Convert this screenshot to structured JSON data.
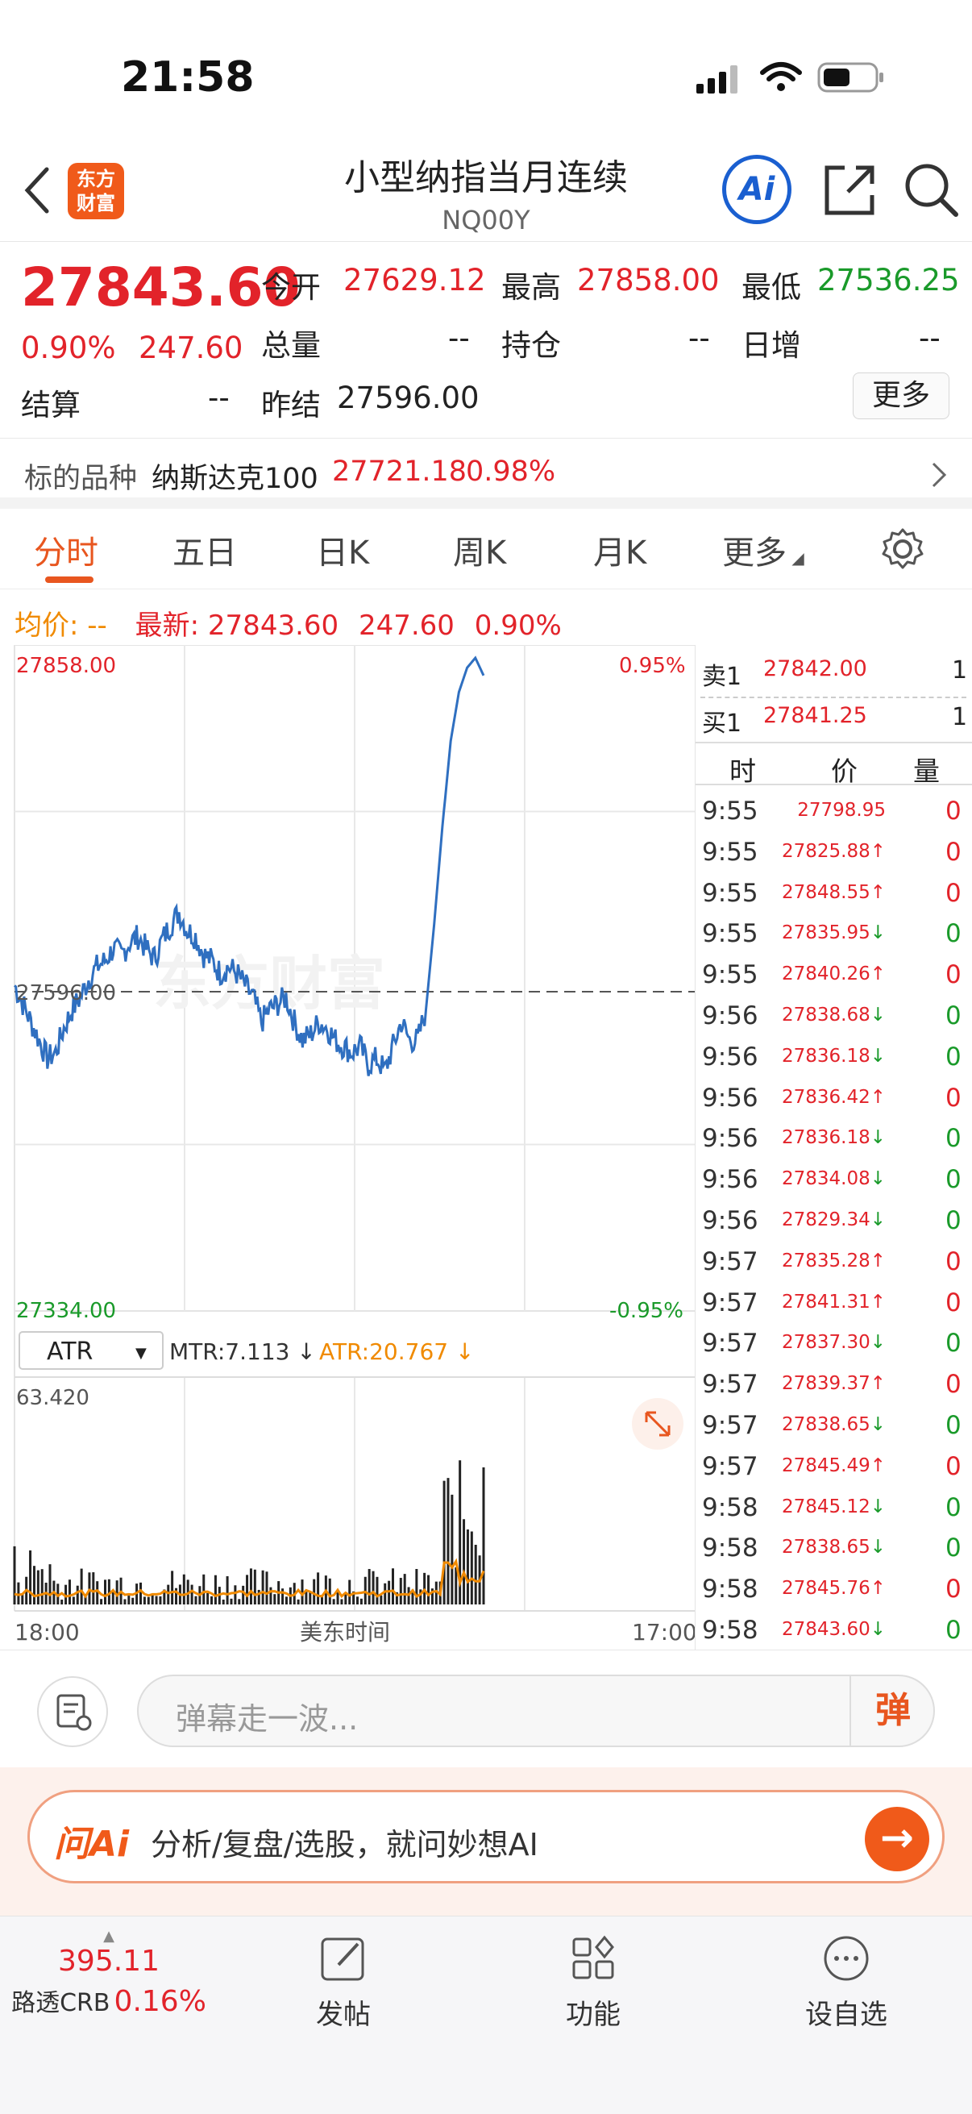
{
  "status_bar": {
    "time": "21:58"
  },
  "header": {
    "title": "小型纳指当月连续",
    "code": "NQ00Y",
    "logo_text": "东方财富",
    "ai_label": "Ai"
  },
  "quote": {
    "price": "27843.60",
    "change_pct": "0.90%",
    "change": "247.60",
    "open_label": "今开",
    "open": "27629.12",
    "high_label": "最高",
    "high": "27858.00",
    "low_label": "最低",
    "low": "27536.25",
    "volume_label": "总量",
    "volume": "--",
    "position_label": "持仓",
    "position": "--",
    "daily_inc_label": "日增",
    "daily_inc": "--",
    "settle_label": "结算",
    "settle": "--",
    "prev_settle_label": "昨结",
    "prev_settle": "27596.00",
    "more_label": "更多"
  },
  "underlying": {
    "label": "标的品种",
    "name": "纳斯达克100",
    "price": "27721.18",
    "pct": "0.98%"
  },
  "tabs": [
    "分时",
    "五日",
    "日K",
    "周K",
    "月K",
    "更多"
  ],
  "avg_row": {
    "avg_label": "均价:",
    "avg_value": "--",
    "latest_label": "最新:",
    "latest": "27843.60",
    "change": "247.60",
    "pct": "0.90%"
  },
  "chart_data": {
    "type": "line",
    "price_top": "27858.00",
    "price_bottom": "27334.00",
    "price_mid": "27596.00",
    "pct_top": "0.95%",
    "pct_bottom": "-0.95%",
    "ylim": [
      27334.0,
      27858.0
    ],
    "series": [
      {
        "values": [
          27590,
          27575,
          27560,
          27545,
          27530,
          27535,
          27555,
          27570,
          27580,
          27595,
          27605,
          27610,
          27620,
          27615,
          27625,
          27630,
          27620,
          27612,
          27628,
          27640,
          27650,
          27635,
          27630,
          27615,
          27610,
          27600,
          27605,
          27600,
          27590,
          27580,
          27560,
          27570,
          27575,
          27580,
          27560,
          27545,
          27550,
          27560,
          27555,
          27545,
          27540,
          27535,
          27540,
          27525,
          27530,
          27520,
          27540,
          27560,
          27545,
          27545,
          27570,
          27640,
          27720,
          27790,
          27830,
          27850,
          27858,
          27843.6
        ]
      }
    ],
    "indicator": {
      "selector": "ATR",
      "mtr_label": "MTR:7.113",
      "atr_label": "ATR:20.767",
      "max_label": "63.420",
      "x_start": "18:00",
      "x_mid": "美东时间",
      "x_end": "17:00"
    }
  },
  "order_book": {
    "sell_label": "卖1",
    "sell_price": "27842.00",
    "sell_qty": "1",
    "buy_label": "买1",
    "buy_price": "27841.25",
    "buy_qty": "1",
    "col_time": "时",
    "col_price": "价",
    "col_qty": "量",
    "ticks": [
      {
        "t": "9:55",
        "p": "27798.95",
        "d": "",
        "v": "0",
        "c": "red"
      },
      {
        "t": "9:55",
        "p": "27825.88",
        "d": "↑",
        "v": "0",
        "c": "red"
      },
      {
        "t": "9:55",
        "p": "27848.55",
        "d": "↑",
        "v": "0",
        "c": "red"
      },
      {
        "t": "9:55",
        "p": "27835.95",
        "d": "↓",
        "v": "0",
        "c": "green"
      },
      {
        "t": "9:55",
        "p": "27840.26",
        "d": "↑",
        "v": "0",
        "c": "red"
      },
      {
        "t": "9:56",
        "p": "27838.68",
        "d": "↓",
        "v": "0",
        "c": "green"
      },
      {
        "t": "9:56",
        "p": "27836.18",
        "d": "↓",
        "v": "0",
        "c": "green"
      },
      {
        "t": "9:56",
        "p": "27836.42",
        "d": "↑",
        "v": "0",
        "c": "red"
      },
      {
        "t": "9:56",
        "p": "27836.18",
        "d": "↓",
        "v": "0",
        "c": "green"
      },
      {
        "t": "9:56",
        "p": "27834.08",
        "d": "↓",
        "v": "0",
        "c": "green"
      },
      {
        "t": "9:56",
        "p": "27829.34",
        "d": "↓",
        "v": "0",
        "c": "green"
      },
      {
        "t": "9:57",
        "p": "27835.28",
        "d": "↑",
        "v": "0",
        "c": "red"
      },
      {
        "t": "9:57",
        "p": "27841.31",
        "d": "↑",
        "v": "0",
        "c": "red"
      },
      {
        "t": "9:57",
        "p": "27837.30",
        "d": "↓",
        "v": "0",
        "c": "green"
      },
      {
        "t": "9:57",
        "p": "27839.37",
        "d": "↑",
        "v": "0",
        "c": "red"
      },
      {
        "t": "9:57",
        "p": "27838.65",
        "d": "↓",
        "v": "0",
        "c": "green"
      },
      {
        "t": "9:57",
        "p": "27845.49",
        "d": "↑",
        "v": "0",
        "c": "red"
      },
      {
        "t": "9:58",
        "p": "27845.12",
        "d": "↓",
        "v": "0",
        "c": "green"
      },
      {
        "t": "9:58",
        "p": "27838.65",
        "d": "↓",
        "v": "0",
        "c": "green"
      },
      {
        "t": "9:58",
        "p": "27845.76",
        "d": "↑",
        "v": "0",
        "c": "red"
      },
      {
        "t": "9:58",
        "p": "27843.60",
        "d": "↓",
        "v": "0",
        "c": "green"
      }
    ]
  },
  "composer": {
    "placeholder": "弹幕走一波...",
    "danmu_btn": "弹"
  },
  "ai_bar": {
    "logo": "问Ai",
    "text": "分析/复盘/选股，就问妙想AI"
  },
  "bottom_nav": {
    "index_value": "395.11",
    "index_name": "路透CRB",
    "index_pct": "0.16%",
    "post": "发帖",
    "features": "功能",
    "watchlist": "设自选"
  },
  "colors": {
    "up": "#e2232a",
    "down": "#1a9a2a",
    "accent": "#e8561f",
    "line": "#2f6fc0",
    "atr": "#f08a00"
  }
}
